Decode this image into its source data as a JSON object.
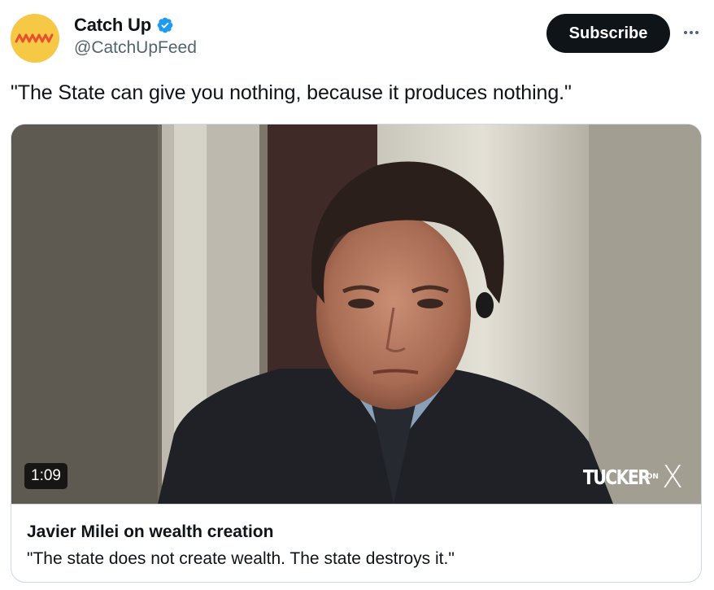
{
  "author": {
    "display_name": "Catch Up",
    "handle": "@CatchUpFeed",
    "avatar_icon": "orange-wave-logo",
    "verified_icon": "verified-badge-icon",
    "avatar_bg": "#f5c945",
    "verified_color": "#1d9bf0"
  },
  "actions": {
    "subscribe_label": "Subscribe",
    "more_icon": "more-options-icon"
  },
  "tweet": {
    "text": "\"The State can give you nothing, because it produces nothing.\""
  },
  "card": {
    "duration": "1:09",
    "watermark_main": "TUCKER",
    "watermark_on": "ON",
    "watermark_x": "X",
    "title": "Javier Milei on wealth creation",
    "description": "\"The state does not create wealth. The state destroys it.\""
  }
}
